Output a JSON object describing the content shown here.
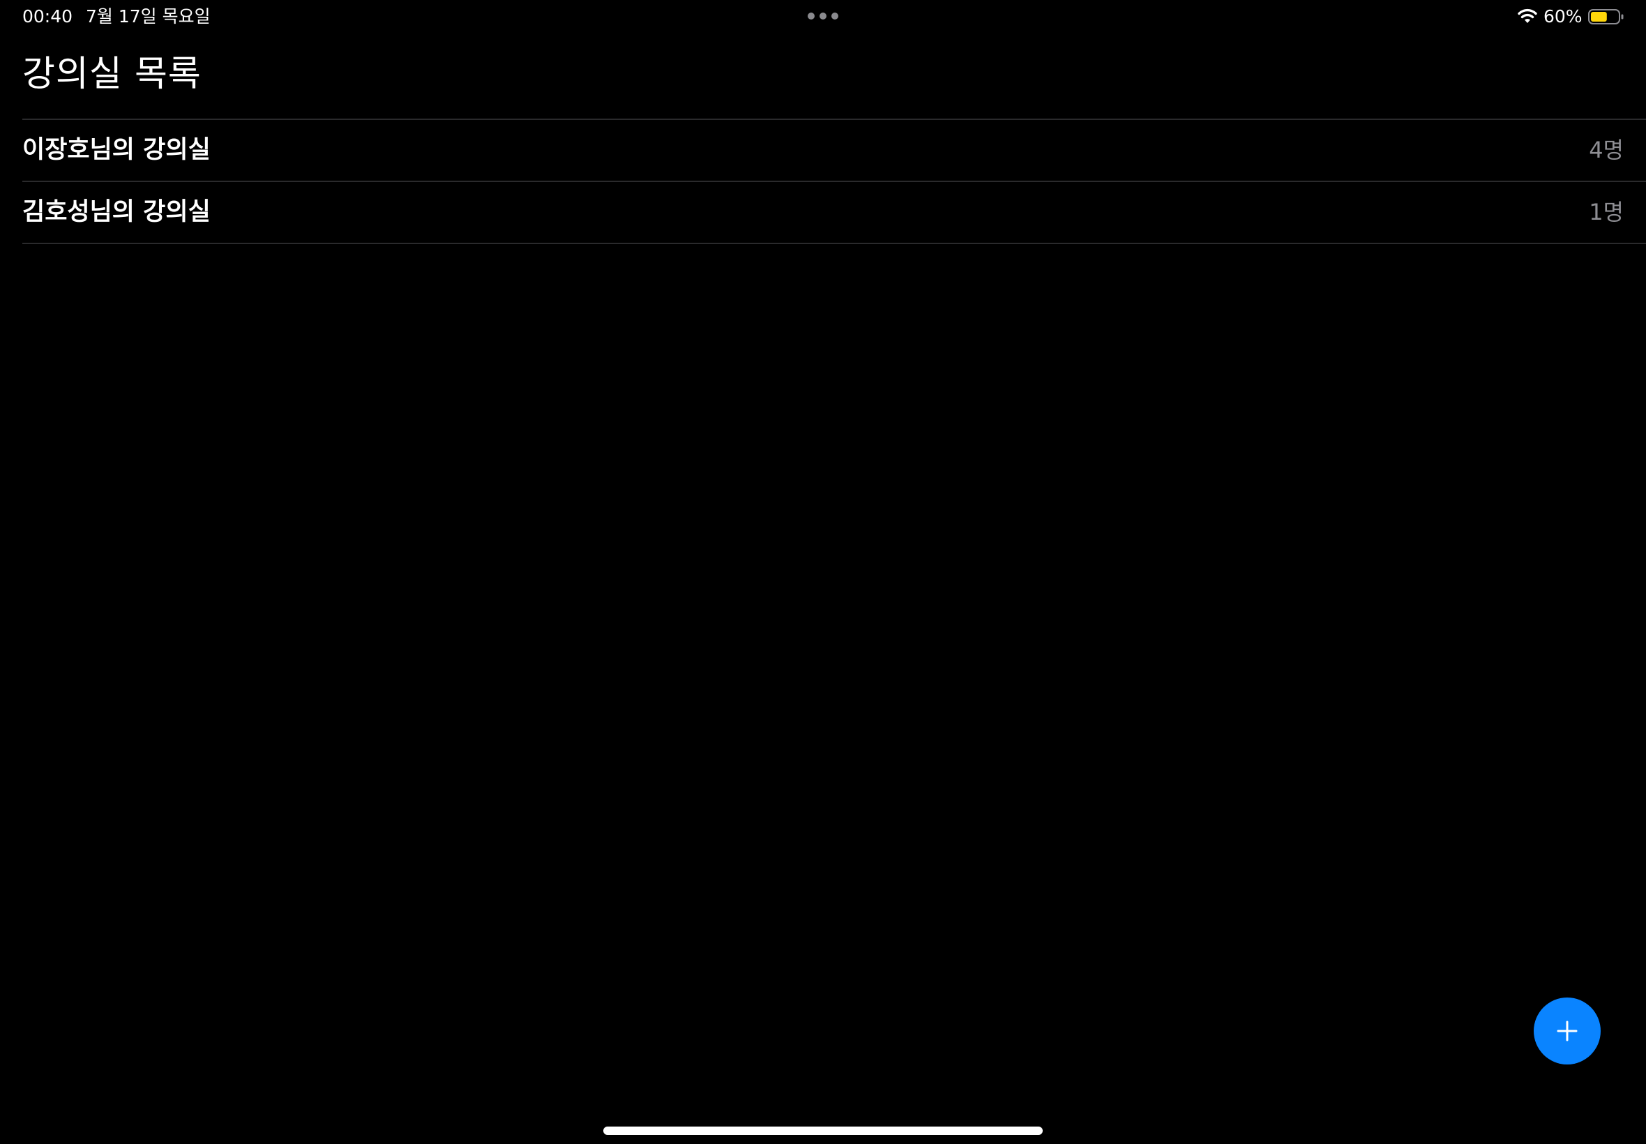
{
  "status_bar": {
    "time": "00:40",
    "date": "7월 17일 목요일",
    "battery_percent": "60%",
    "battery_level": 0.6,
    "battery_color": "#FFD60A",
    "wifi_icon": "wifi-icon",
    "multitask_icon": "more-dots-icon"
  },
  "header": {
    "title": "강의실 목록"
  },
  "rooms": [
    {
      "name": "이장호님의 강의실",
      "count": "4명"
    },
    {
      "name": "김호성님의 강의실",
      "count": "1명"
    }
  ],
  "fab": {
    "icon": "plus-icon",
    "color": "#0A84FF"
  }
}
